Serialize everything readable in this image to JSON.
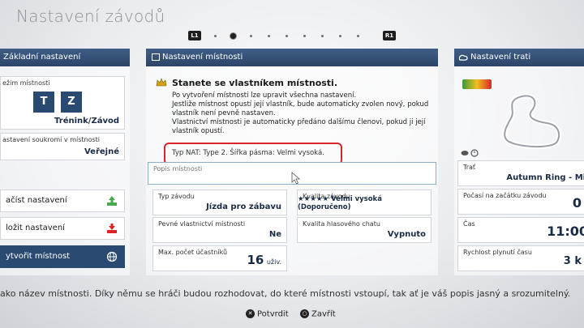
{
  "page_title": "Nastavení závodů",
  "pager": {
    "left": "L1",
    "right": "R1"
  },
  "left": {
    "header": "Základní nastavení",
    "room_mode_label": "ežim místnosti",
    "btn_t": "T",
    "btn_z": "Z",
    "room_mode_value": "Trénink/Závod",
    "privacy_label": "astavení soukromí v místnosti",
    "privacy_value": "Veřejné",
    "load_label": "ačíst nastavení",
    "save_label": "ložit nastavení",
    "create_label": "ytvořit místnost"
  },
  "center": {
    "header": "Nastavení místnosti",
    "owner_title": "Stanete se vlastníkem místnosti.",
    "owner_text": [
      "Po vytvoření místnosti lze upravit všechna nastavení.",
      "Jestliže místnost opustí její vlastník, bude automaticky zvolen nový, pokud",
      "vlastník není pevně nastaven.",
      "Vlastnictví místnosti je automaticky předáno dalšímu členovi, pokud ji její",
      "vlastník opustí."
    ],
    "nat_text": "Typ NAT: Type 2. Šířka pásma: Velmi vysoká.",
    "desc_placeholder": "Popis místnosti",
    "race_type_label": "Typ závodu",
    "race_type_value": "Jízda pro zábavu",
    "quality_label": "Kvalita závodu",
    "quality_value": "★★★★★ Velmi vysoká (Doporučeno)",
    "fixed_owner_label": "Pevné vlastnictví místnosti",
    "fixed_owner_value": "Ne",
    "voice_label": "Kvalita hlasového chatu",
    "voice_value": "Vypnuto",
    "max_label": "Max. počet účastníků",
    "max_value": "16",
    "max_unit": "uživ."
  },
  "right": {
    "header": "Nastavení trati",
    "track_label": "Trať",
    "track_value": "Autumn Ring - Mir",
    "time_label": "Počasí na začátku závodu",
    "time_value": "0",
    "clock_label": "Čas",
    "clock_value": "11:00",
    "speed_label": "Rychlost plynutí času",
    "speed_value": "3 k"
  },
  "hint": "ako název místnosti. Díky němu se hráči budou rozhodovat, do které místnosti vstoupí, tak ať je váš popis jasný a srozumitelný.",
  "footer": {
    "confirm_symbol": "✕",
    "confirm": "Potvrdit",
    "close_symbol": "○",
    "close": "Zavřít"
  },
  "colors": {
    "accent": "#2b4a72",
    "highlight": "#d9252a"
  }
}
